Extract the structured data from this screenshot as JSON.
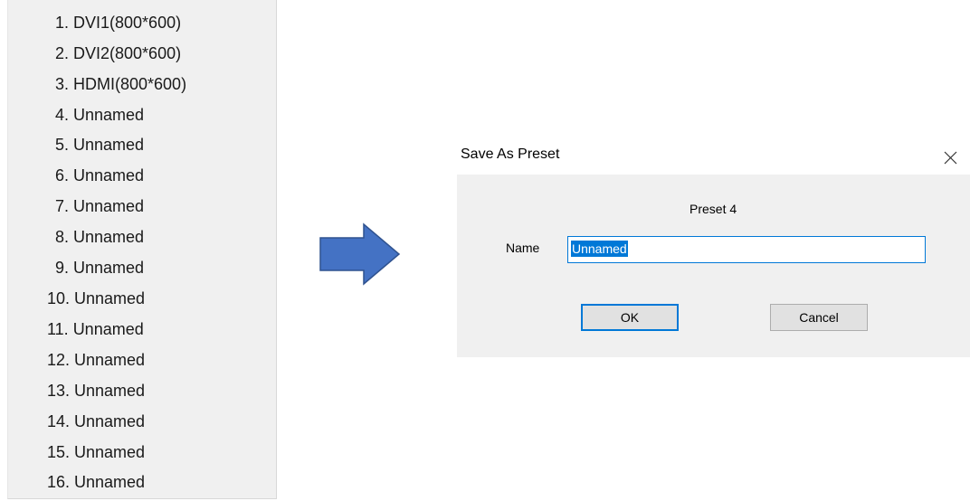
{
  "preset_list": {
    "items": [
      {
        "label": "1. DVI1(800*600)"
      },
      {
        "label": "2. DVI2(800*600)"
      },
      {
        "label": "3. HDMI(800*600)"
      },
      {
        "label": "4. Unnamed"
      },
      {
        "label": "5. Unnamed"
      },
      {
        "label": "6. Unnamed"
      },
      {
        "label": "7. Unnamed"
      },
      {
        "label": "8. Unnamed"
      },
      {
        "label": "9. Unnamed"
      },
      {
        "label": "10. Unnamed"
      },
      {
        "label": "11. Unnamed"
      },
      {
        "label": "12. Unnamed"
      },
      {
        "label": "13. Unnamed"
      },
      {
        "label": "14. Unnamed"
      },
      {
        "label": "15. Unnamed"
      },
      {
        "label": "16. Unnamed"
      }
    ]
  },
  "arrow": {
    "icon": "right-arrow-icon",
    "fill": "#4472c4",
    "stroke": "#2f528f"
  },
  "dialog": {
    "title": "Save As Preset",
    "close_icon": "close-icon",
    "preset_heading": "Preset 4",
    "name_label": "Name",
    "name_value": "Unnamed",
    "ok_label": "OK",
    "cancel_label": "Cancel",
    "accent": "#0078d7"
  }
}
